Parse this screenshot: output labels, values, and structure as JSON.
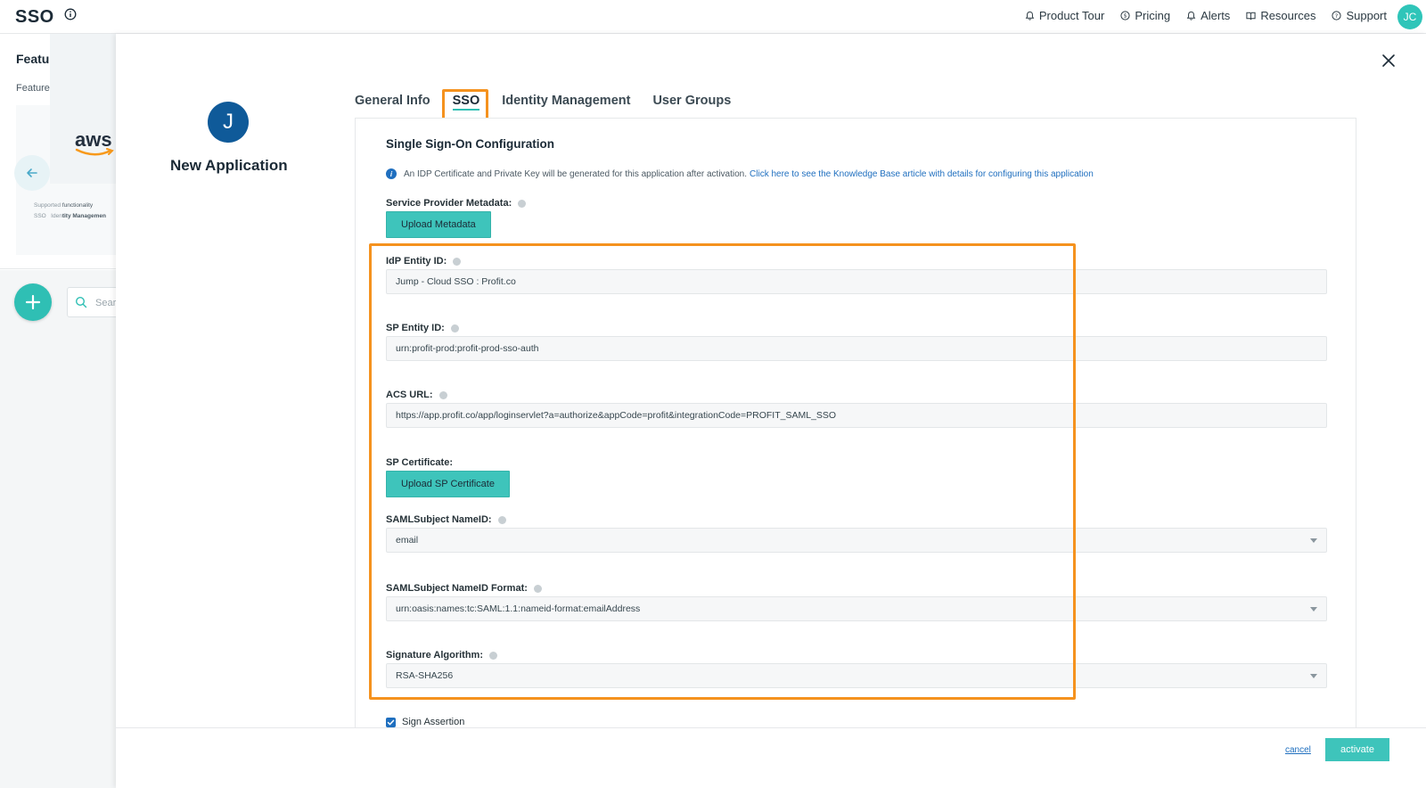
{
  "topbar": {
    "title": "SSO",
    "nav": [
      {
        "label": "Product Tour",
        "icon": "bell-icon"
      },
      {
        "label": "Pricing",
        "icon": "coin-icon"
      },
      {
        "label": "Alerts",
        "icon": "alert-bell-icon"
      },
      {
        "label": "Resources",
        "icon": "book-icon"
      },
      {
        "label": "Support",
        "icon": "help-circle-icon"
      }
    ],
    "user_initials": "JC"
  },
  "background": {
    "featured_title": "Featured Applica",
    "featured_subtitle": "Featured applications a",
    "aws_logo": "aws",
    "supported_prefix": "Supported",
    "supported_label": "functionality",
    "tag_sso": "SSO",
    "tag_idm_prefix": "Iden",
    "tag_idm": "tity Managemen",
    "search_placeholder": "Sear"
  },
  "app": {
    "initial": "J",
    "name": "New Application"
  },
  "tabs": [
    {
      "label": "General Info",
      "active": false
    },
    {
      "label": "SSO",
      "active": true
    },
    {
      "label": "Identity Management",
      "active": false
    },
    {
      "label": "User Groups",
      "active": false
    }
  ],
  "sso": {
    "title": "Single Sign-On Configuration",
    "notice_text": "An IDP Certificate and Private Key will be generated for this application after activation.",
    "notice_link": "Click here to see the Knowledge Base article with details for configuring this application",
    "sp_metadata_label": "Service Provider Metadata:",
    "upload_metadata_label": "Upload Metadata",
    "idp_entity_label": "IdP Entity ID:",
    "idp_entity_value": "Jump - Cloud SSO : Profit.co",
    "sp_entity_label": "SP Entity ID:",
    "sp_entity_value": "urn:profit-prod:profit-prod-sso-auth",
    "acs_label": "ACS URL:",
    "acs_value": "https://app.profit.co/app/loginservlet?a=authorize&appCode=profit&integrationCode=PROFIT_SAML_SSO",
    "sp_cert_label": "SP Certificate:",
    "upload_cert_label": "Upload SP Certificate",
    "nameid_label": "SAMLSubject NameID:",
    "nameid_value": "email",
    "nameid_format_label": "SAMLSubject NameID Format:",
    "nameid_format_value": "urn:oasis:names:tc:SAML:1.1:nameid-format:emailAddress",
    "sig_alg_label": "Signature Algorithm:",
    "sig_alg_value": "RSA-SHA256",
    "sign_assertion_label": "Sign Assertion"
  },
  "footer": {
    "cancel_label": "cancel",
    "activate_label": "activate"
  },
  "colors": {
    "accent": "#3ec4bb",
    "highlight": "#f5921e",
    "link": "#1f6fbf",
    "avatar": "#0f5a99"
  }
}
